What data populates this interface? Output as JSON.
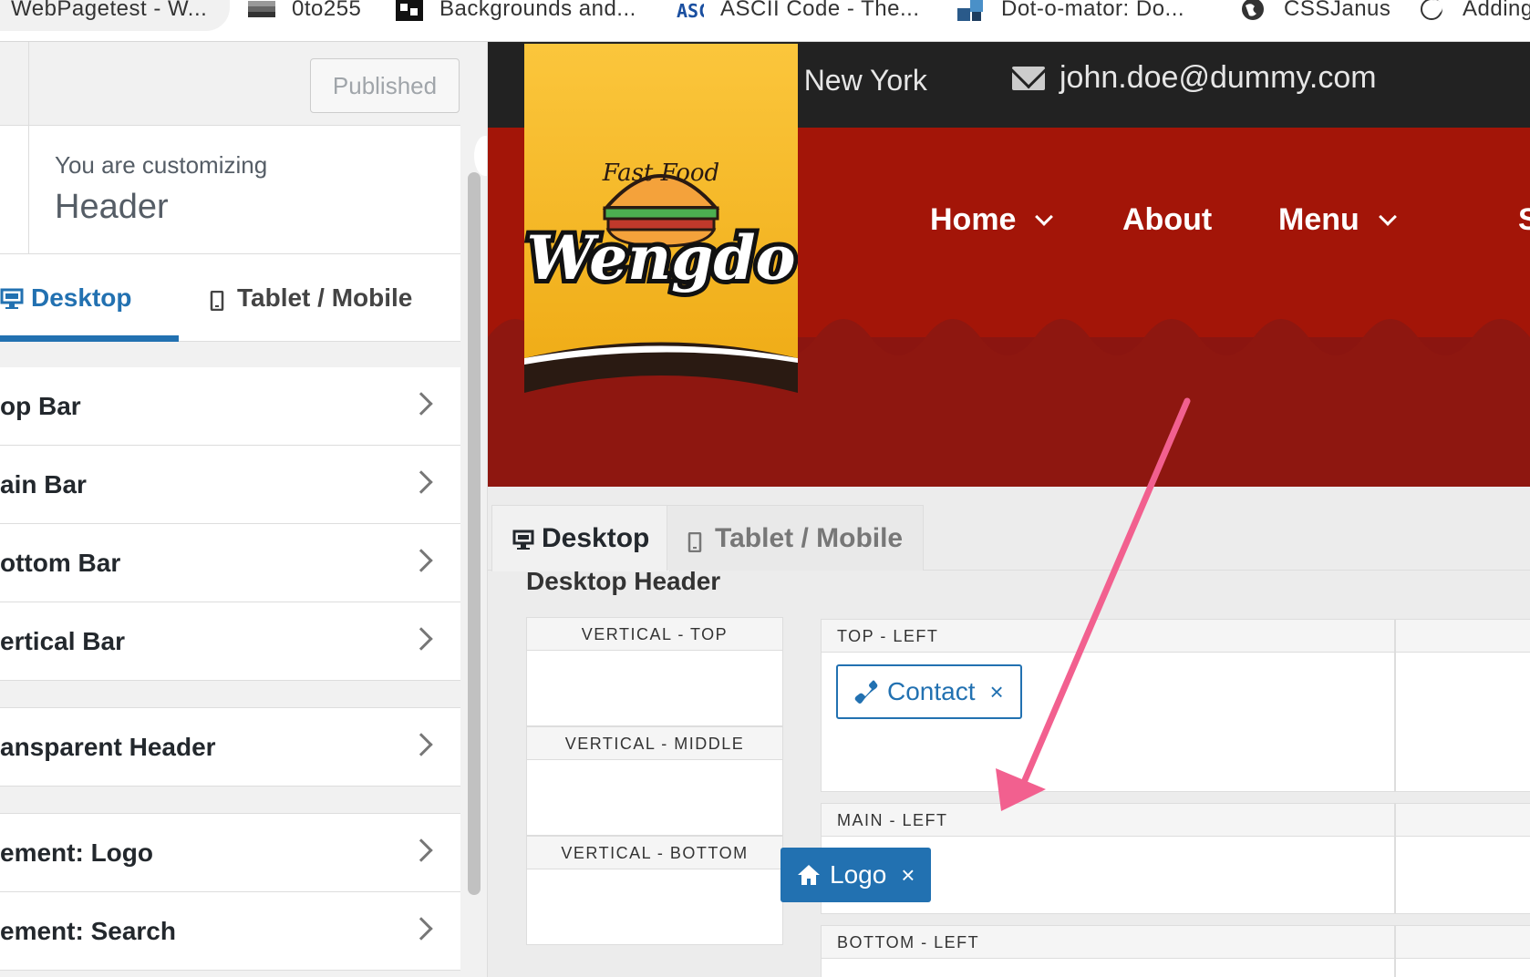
{
  "bookmarks": [
    {
      "label": "WebPagetest - W...",
      "icon": "webpagetest-icon"
    },
    {
      "label": "0to255",
      "icon": "color-gradient-icon"
    },
    {
      "label": "Backgrounds and...",
      "icon": "bg-patterns-icon"
    },
    {
      "label": "ASCII Code - The...",
      "icon": "ascii-icon"
    },
    {
      "label": "Dot-o-mator: Do...",
      "icon": "dotomator-icon"
    },
    {
      "label": "CSSJanus",
      "icon": "globe-icon"
    },
    {
      "label": "Adding",
      "icon": "moon-icon"
    }
  ],
  "customizer": {
    "publish_label": "Published",
    "customizing_label": "You are customizing",
    "section_title": "Header",
    "tabs": [
      {
        "label": "Desktop",
        "icon": "desktop-icon",
        "active": true
      },
      {
        "label": "Tablet / Mobile",
        "icon": "mobile-icon",
        "active": false
      }
    ],
    "groups": [
      [
        "op Bar",
        "ain Bar",
        "ottom Bar",
        "ertical Bar"
      ],
      [
        "ansparent Header"
      ],
      [
        "ement: Logo",
        "ement: Search"
      ]
    ]
  },
  "preview": {
    "topbar": {
      "location": "e New York",
      "email": "john.doe@dummy.com"
    },
    "logo": {
      "brand": "Wengdo",
      "tagline": "Fast Food"
    },
    "nav": [
      {
        "label": "Home",
        "dropdown": true
      },
      {
        "label": "About",
        "dropdown": false
      },
      {
        "label": "Menu",
        "dropdown": true
      },
      {
        "label": "S",
        "dropdown": false
      }
    ],
    "builder_tabs": [
      {
        "label": "Desktop",
        "icon": "desktop-icon",
        "active": true
      },
      {
        "label": "Tablet / Mobile",
        "icon": "mobile-icon",
        "active": false
      }
    ],
    "builder_title": "Desktop Header",
    "vertical_zones": [
      "VERTICAL - TOP",
      "VERTICAL - MIDDLE",
      "VERTICAL - BOTTOM"
    ],
    "zones": [
      {
        "label": "TOP - LEFT",
        "items": [
          {
            "label": "Contact",
            "icon": "phone-icon",
            "remove": "×"
          }
        ]
      },
      {
        "label": "MAIN - LEFT",
        "items": [
          {
            "label": "Logo",
            "icon": "home-icon",
            "remove": "×"
          }
        ]
      },
      {
        "label": "BOTTOM - LEFT",
        "items": []
      }
    ]
  },
  "colors": {
    "accent": "#2271b1",
    "topbar": "#222222",
    "hero_red": "#a31508",
    "annotation_arrow": "#f2608f",
    "logo_yellow": "#f9c22e"
  }
}
